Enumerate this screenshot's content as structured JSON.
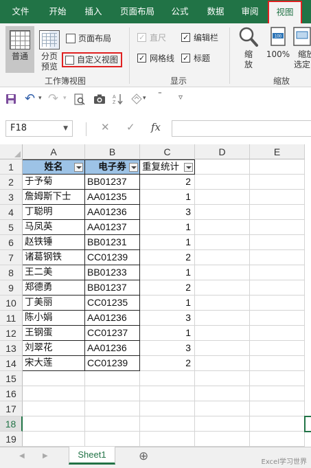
{
  "ribbon_tabs": [
    "文件",
    "开始",
    "插入",
    "页面布局",
    "公式",
    "数据",
    "审阅",
    "视图"
  ],
  "workbook_views": {
    "normal": "普通",
    "page_break_1": "分页",
    "page_break_2": "预览",
    "page_layout": "页面布局",
    "custom_views": "自定义视图",
    "group_label": "工作簿视图"
  },
  "show": {
    "ruler": "直尺",
    "formula_bar": "编辑栏",
    "gridlines": "网格线",
    "headings": "标题",
    "group_label": "显示"
  },
  "zoom": {
    "zoom_1": "缩",
    "zoom_2": "放",
    "zoom_100": "100%",
    "zoom_sel_1": "缩放",
    "zoom_sel_2": "选定区",
    "group_label": "缩放"
  },
  "formula_bar": {
    "name_box": "F18",
    "cancel": "✕",
    "enter": "✓",
    "fx": "fx"
  },
  "columns": [
    "A",
    "B",
    "C",
    "D",
    "E"
  ],
  "rows": [
    "1",
    "2",
    "3",
    "4",
    "5",
    "6",
    "7",
    "8",
    "9",
    "10",
    "11",
    "12",
    "13",
    "14",
    "15",
    "16",
    "17",
    "18",
    "19"
  ],
  "table": {
    "headers": [
      "姓名",
      "电子券",
      "重复统计"
    ],
    "rows": [
      {
        "name": "于予菊",
        "code": "BB01237",
        "count": "2"
      },
      {
        "name": "詹姆斯下士",
        "code": "AA01235",
        "count": "1"
      },
      {
        "name": "丁聪明",
        "code": "AA01236",
        "count": "3"
      },
      {
        "name": "马凤英",
        "code": "AA01237",
        "count": "1"
      },
      {
        "name": "赵铁锤",
        "code": "BB01231",
        "count": "1"
      },
      {
        "name": "诸葛钢铁",
        "code": "CC01239",
        "count": "2"
      },
      {
        "name": "王二美",
        "code": "BB01233",
        "count": "1"
      },
      {
        "name": "郑德勇",
        "code": "BB01237",
        "count": "2"
      },
      {
        "name": "丁美丽",
        "code": "CC01235",
        "count": "1"
      },
      {
        "name": "陈小娟",
        "code": "AA01236",
        "count": "3"
      },
      {
        "name": "王钢蛋",
        "code": "CC01237",
        "count": "1"
      },
      {
        "name": "刘翠花",
        "code": "AA01236",
        "count": "3"
      },
      {
        "name": "宋大莲",
        "code": "CC01239",
        "count": "2"
      }
    ]
  },
  "sheet_tab": "Sheet1",
  "add_sheet": "⊕",
  "watermark": "Excel学习世界",
  "colors": {
    "excel_green": "#217346",
    "header_fill": "#9dc3e6",
    "highlight_red": "#e02020"
  }
}
